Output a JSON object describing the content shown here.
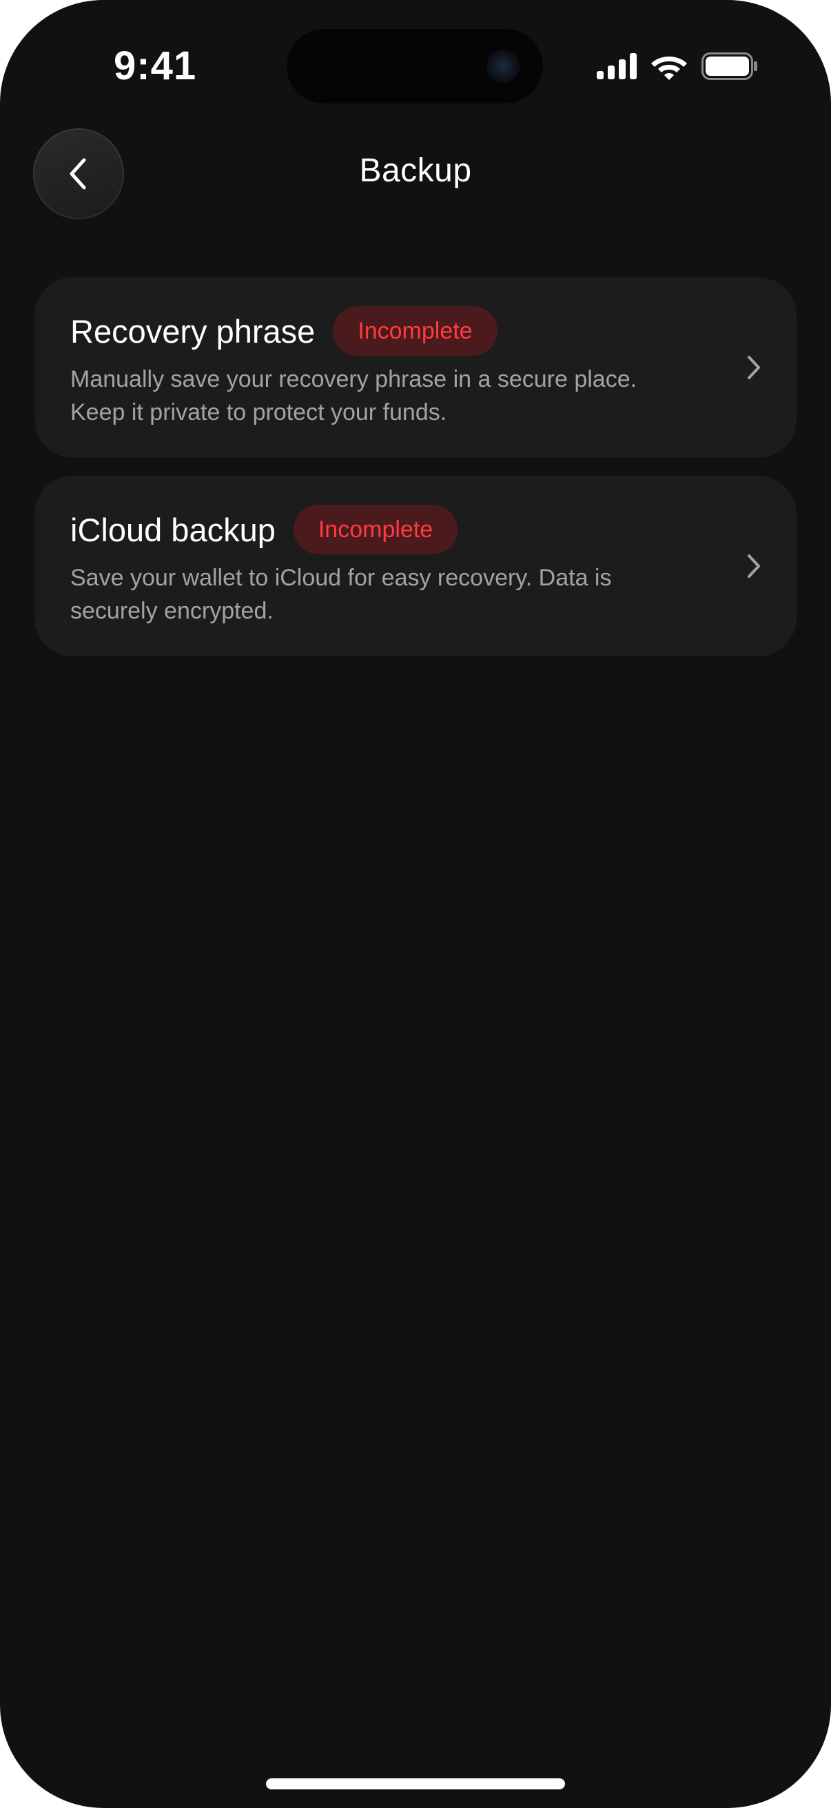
{
  "status_bar": {
    "time": "9:41"
  },
  "header": {
    "title": "Backup",
    "back_icon": "chevron-left-icon"
  },
  "cards": [
    {
      "title": "Recovery phrase",
      "badge": "Incomplete",
      "description": "Manually save your recovery phrase in a secure place. Keep it private to protect your funds."
    },
    {
      "title": "iCloud backup",
      "badge": "Incomplete",
      "description": "Save your wallet to iCloud for easy recovery. Data is securely encrypted."
    }
  ],
  "colors": {
    "background": "#111111",
    "card": "#1c1c1c",
    "badge_background": "#4a1a1d",
    "badge_text": "#ff3b3f",
    "secondary_text": "#a3a3a3"
  }
}
